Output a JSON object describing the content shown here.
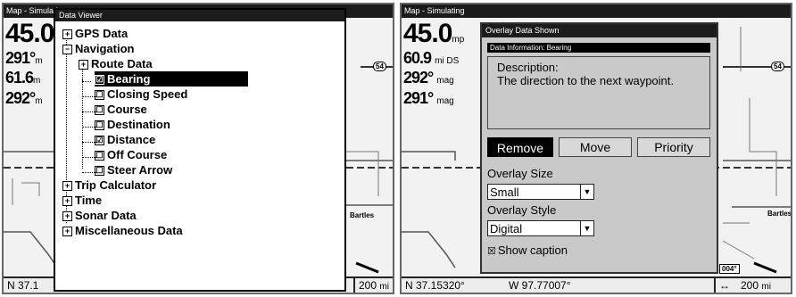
{
  "left": {
    "title": "Map - Simulati",
    "readouts": {
      "speed": "45.0",
      "bearing": "291°",
      "bearing_unit": "m",
      "distance": "61.6",
      "distance_unit": "m",
      "course": "292°",
      "course_unit": "m"
    },
    "status": {
      "lat": "N  37.1",
      "zoom": "200",
      "zoom_unit": "mi"
    },
    "data_viewer": {
      "title": "Data Viewer",
      "items": [
        {
          "label": "GPS Data",
          "expander": "+"
        },
        {
          "label": "Navigation",
          "expander": "−"
        },
        {
          "label": "Route Data",
          "expander": "+"
        },
        {
          "label": "Bearing",
          "check": "☑",
          "selected": true
        },
        {
          "label": "Closing Speed",
          "check": "☐"
        },
        {
          "label": "Course",
          "check": "☐"
        },
        {
          "label": "Destination",
          "check": "☐"
        },
        {
          "label": "Distance",
          "check": "☑"
        },
        {
          "label": "Off Course",
          "check": "☐"
        },
        {
          "label": "Steer Arrow",
          "check": "☐"
        },
        {
          "label": "Trip Calculator",
          "expander": "+"
        },
        {
          "label": "Time",
          "expander": "+"
        },
        {
          "label": "Sonar Data",
          "expander": "+"
        },
        {
          "label": "Miscellaneous Data",
          "expander": "+"
        }
      ]
    },
    "map_labels": {
      "route": "54"
    }
  },
  "right": {
    "title": "Map - Simulating",
    "readouts": {
      "speed": "45.0",
      "speed_unit": "mp",
      "distance": "60.9",
      "distance_unit": "mi DS",
      "bearing": "292°",
      "bearing_unit": "mag",
      "course": "291°",
      "course_unit": "mag"
    },
    "status": {
      "lat": "N   37.15320°",
      "lon": "W    97.77007°",
      "zoom": "200",
      "zoom_unit": "mi",
      "zoom_icon": "↔"
    },
    "map_labels": {
      "route": "54",
      "town": "Bartles",
      "heading": "004°"
    },
    "overlay": {
      "title": "Overlay Data Shown",
      "info_title": "Data Information: Bearing",
      "description_label": "Description:",
      "description_text": "The direction to the next waypoint.",
      "buttons": {
        "remove": "Remove",
        "move": "Move",
        "priority": "Priority"
      },
      "size_label": "Overlay Size",
      "size_value": "Small",
      "style_label": "Overlay Style",
      "style_value": "Digital",
      "caption_check": "☒",
      "caption_label": "Show caption"
    }
  },
  "left_map_town": "Bartles"
}
